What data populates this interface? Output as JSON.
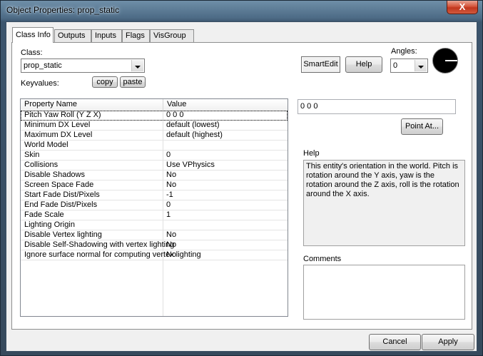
{
  "window": {
    "title": "Object Properties: prop_static",
    "close_label": "X"
  },
  "tabs": [
    {
      "label": "Class Info",
      "active": true
    },
    {
      "label": "Outputs"
    },
    {
      "label": "Inputs"
    },
    {
      "label": "Flags"
    },
    {
      "label": "VisGroup"
    }
  ],
  "class_section": {
    "label": "Class:",
    "value": "prop_static"
  },
  "keyvalues": {
    "label": "Keyvalues:",
    "copy_label": "copy",
    "paste_label": "paste"
  },
  "smartedit_label": "SmartEdit",
  "help_button_label": "Help",
  "angles": {
    "label": "Angles:",
    "value": "0"
  },
  "grid": {
    "col_property": "Property Name",
    "col_value": "Value",
    "rows": [
      {
        "name": "Pitch Yaw Roll (Y Z X)",
        "value": "0 0 0",
        "selected": true
      },
      {
        "name": "Minimum DX Level",
        "value": "default (lowest)"
      },
      {
        "name": "Maximum DX Level",
        "value": "default (highest)"
      },
      {
        "name": "World Model",
        "value": ""
      },
      {
        "name": "Skin",
        "value": "0"
      },
      {
        "name": "Collisions",
        "value": "Use VPhysics"
      },
      {
        "name": "Disable Shadows",
        "value": "No"
      },
      {
        "name": "Screen Space Fade",
        "value": "No"
      },
      {
        "name": "Start Fade Dist/Pixels",
        "value": "-1"
      },
      {
        "name": "End Fade Dist/Pixels",
        "value": "0"
      },
      {
        "name": "Fade Scale",
        "value": "1"
      },
      {
        "name": "Lighting Origin",
        "value": ""
      },
      {
        "name": "Disable Vertex lighting",
        "value": "No"
      },
      {
        "name": "Disable Self-Shadowing with vertex lighting",
        "value": "No"
      },
      {
        "name": "Ignore surface normal for computing vertex lighting",
        "value": "No"
      }
    ]
  },
  "value_field": "0 0 0",
  "point_at_label": "Point At...",
  "help_section": {
    "label": "Help",
    "text": "This entity's orientation in the world. Pitch is rotation around the Y axis, yaw is the rotation around the Z axis, roll is the rotation around the X axis."
  },
  "comments_label": "Comments",
  "footer": {
    "cancel_label": "Cancel",
    "apply_label": "Apply"
  }
}
